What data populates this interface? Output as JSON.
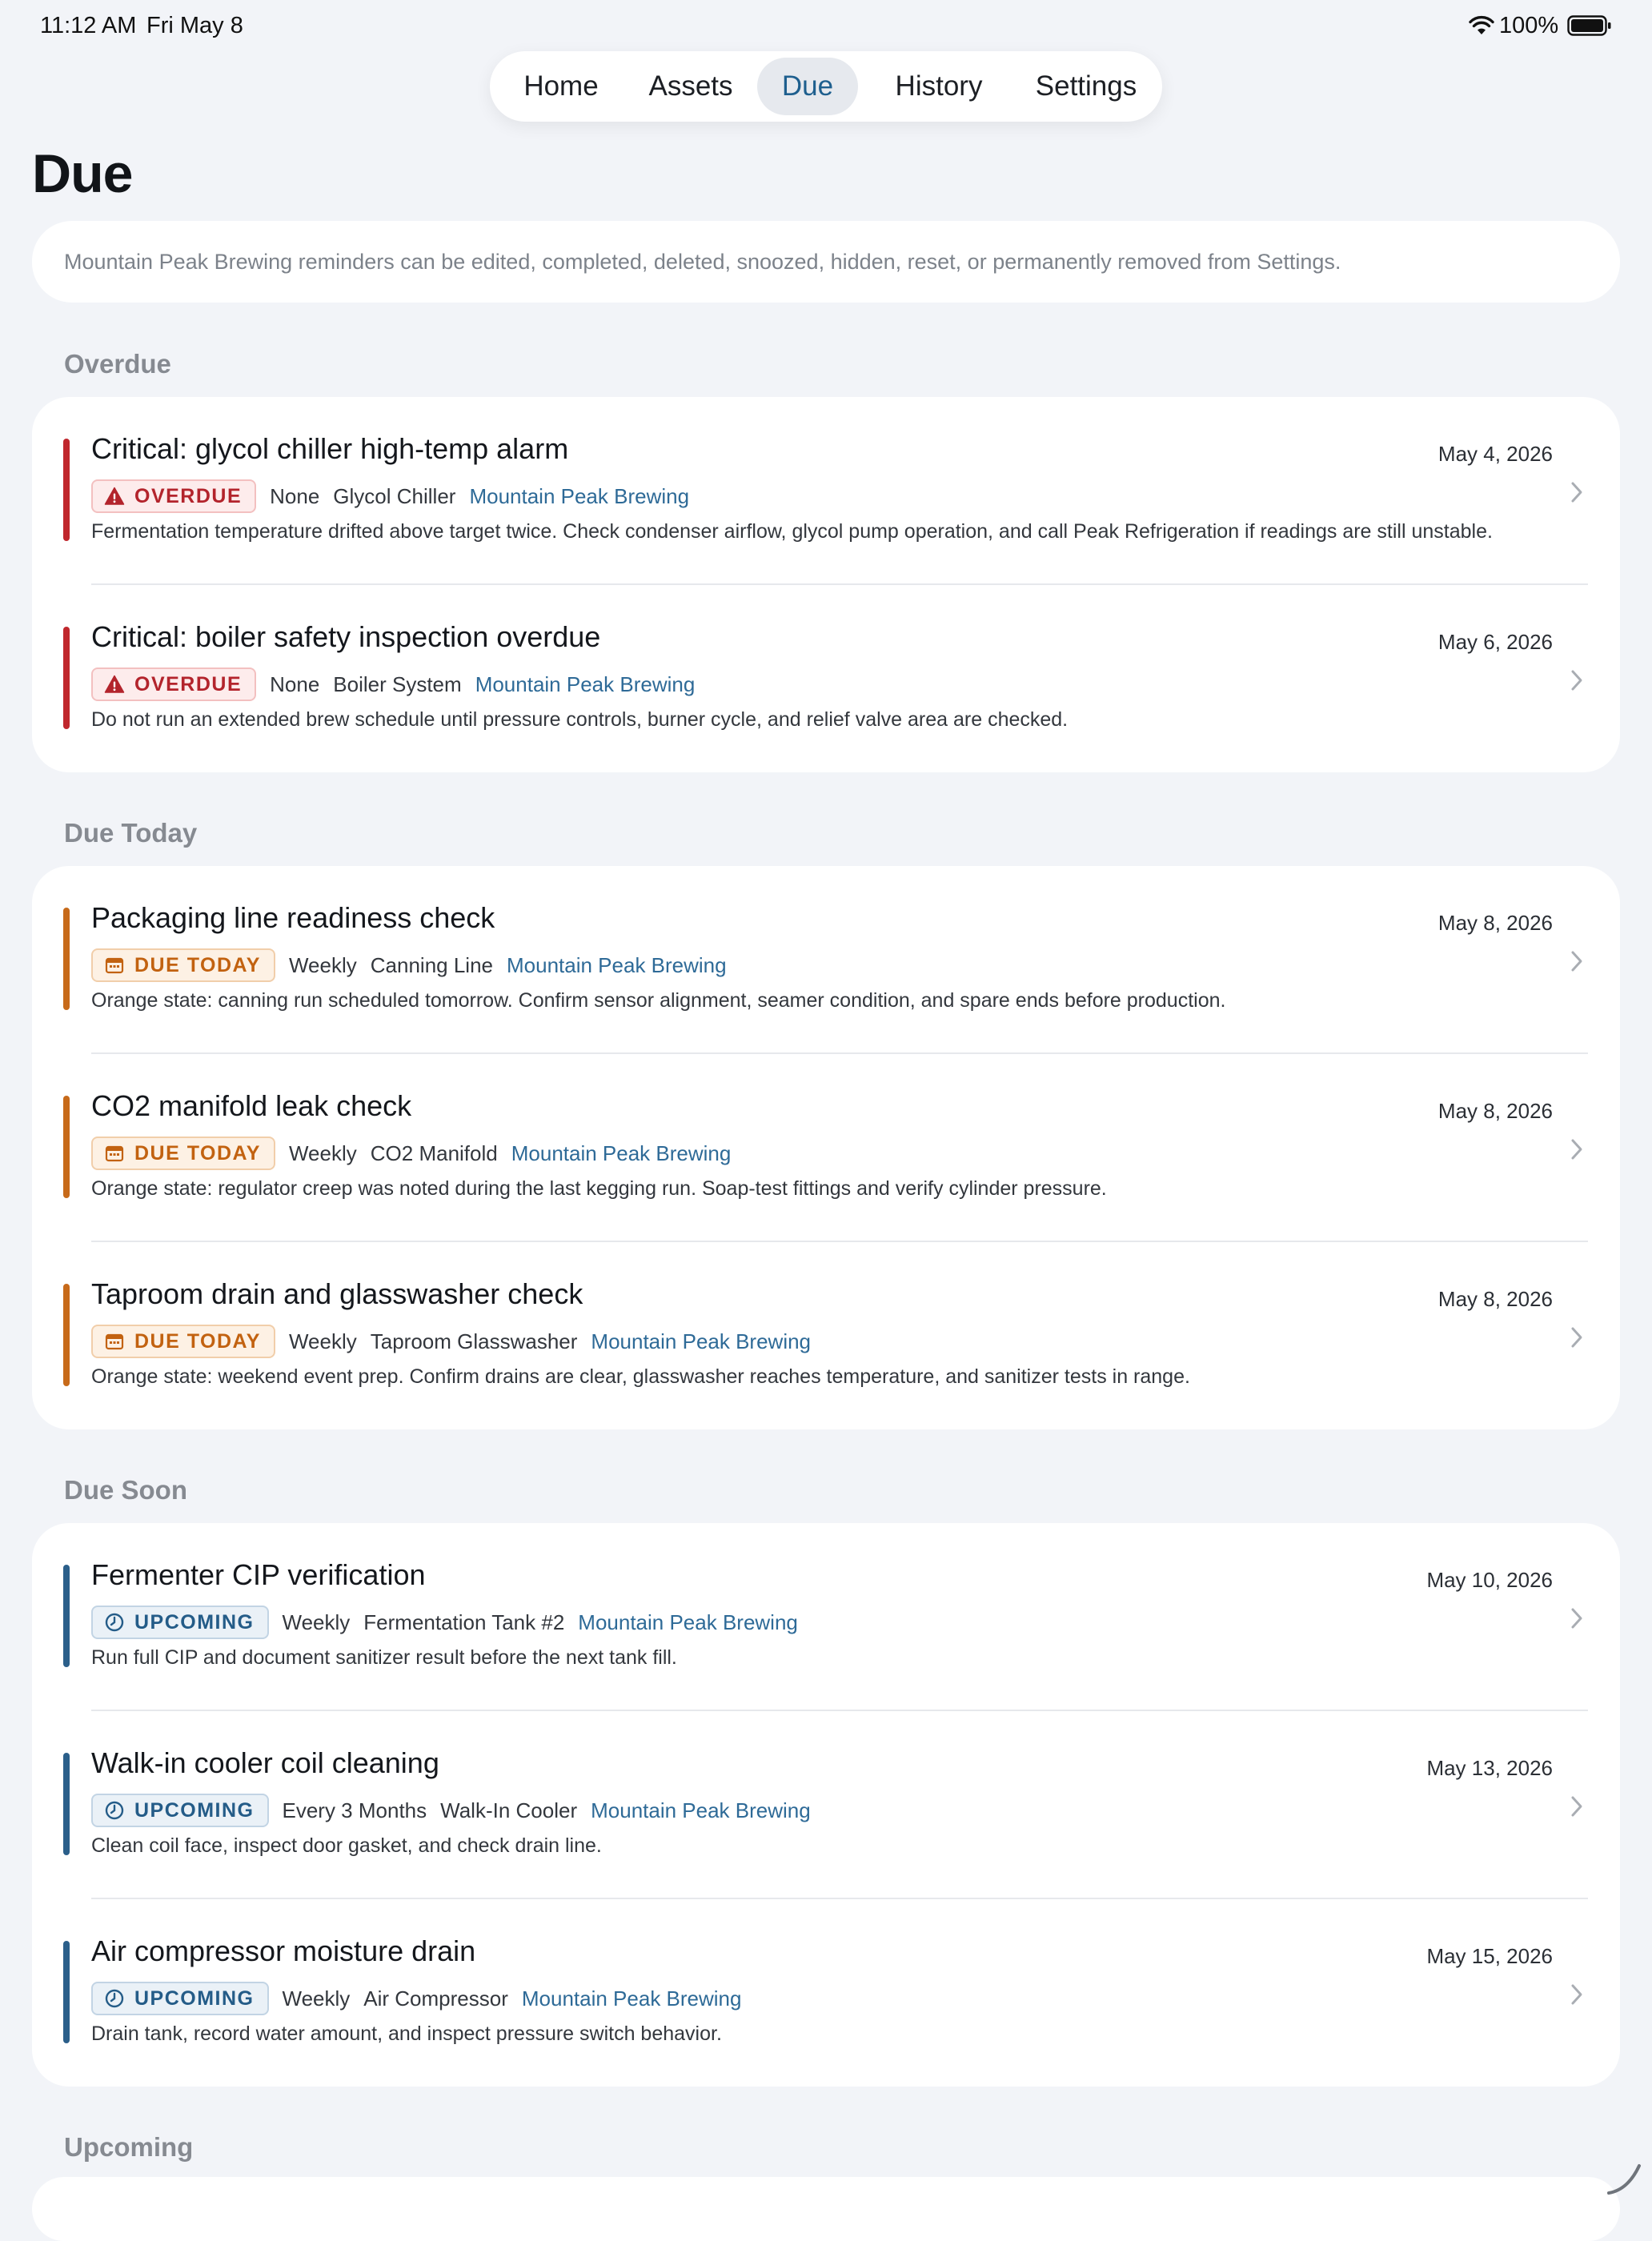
{
  "status_bar": {
    "time": "11:12 AM",
    "date": "Fri May 8",
    "battery": "100%"
  },
  "nav": {
    "tabs": [
      {
        "label": "Home"
      },
      {
        "label": "Assets"
      },
      {
        "label": "Due",
        "active": true
      },
      {
        "label": "History"
      },
      {
        "label": "Settings"
      }
    ]
  },
  "page": {
    "title": "Due",
    "info": "Mountain Peak Brewing reminders can be edited, completed, deleted, snoozed, hidden, reset, or permanently removed from Settings."
  },
  "colors": {
    "overdue": "#c0272d",
    "today": "#c76a1a",
    "upcoming": "#2b5f8a",
    "link": "#2e6a97"
  },
  "sections": [
    {
      "header": "Overdue",
      "items": [
        {
          "title": "Critical: glycol chiller high-temp alarm",
          "date": "May 4, 2026",
          "badge": "OVERDUE",
          "frequency": "None",
          "asset": "Glycol Chiller",
          "site": "Mountain Peak Brewing",
          "note": "Fermentation temperature drifted above target twice. Check condenser airflow, glycol pump operation, and call Peak Refrigeration if readings are still unstable."
        },
        {
          "title": "Critical: boiler safety inspection overdue",
          "date": "May 6, 2026",
          "badge": "OVERDUE",
          "frequency": "None",
          "asset": "Boiler System",
          "site": "Mountain Peak Brewing",
          "note": "Do not run an extended brew schedule until pressure controls, burner cycle, and relief valve area are checked."
        }
      ]
    },
    {
      "header": "Due Today",
      "items": [
        {
          "title": "Packaging line readiness check",
          "date": "May 8, 2026",
          "badge": "DUE TODAY",
          "frequency": "Weekly",
          "asset": "Canning Line",
          "site": "Mountain Peak Brewing",
          "note": "Orange state: canning run scheduled tomorrow. Confirm sensor alignment, seamer condition, and spare ends before production."
        },
        {
          "title": "CO2 manifold leak check",
          "date": "May 8, 2026",
          "badge": "DUE TODAY",
          "frequency": "Weekly",
          "asset": "CO2 Manifold",
          "site": "Mountain Peak Brewing",
          "note": "Orange state: regulator creep was noted during the last kegging run. Soap-test fittings and verify cylinder pressure."
        },
        {
          "title": "Taproom drain and glasswasher check",
          "date": "May 8, 2026",
          "badge": "DUE TODAY",
          "frequency": "Weekly",
          "asset": "Taproom Glasswasher",
          "site": "Mountain Peak Brewing",
          "note": "Orange state: weekend event prep. Confirm drains are clear, glasswasher reaches temperature, and sanitizer tests in range."
        }
      ]
    },
    {
      "header": "Due Soon",
      "items": [
        {
          "title": "Fermenter CIP verification",
          "date": "May 10, 2026",
          "badge": "UPCOMING",
          "frequency": "Weekly",
          "asset": "Fermentation Tank #2",
          "site": "Mountain Peak Brewing",
          "note": "Run full CIP and document sanitizer result before the next tank fill."
        },
        {
          "title": "Walk-in cooler coil cleaning",
          "date": "May 13, 2026",
          "badge": "UPCOMING",
          "frequency": "Every 3 Months",
          "asset": "Walk-In Cooler",
          "site": "Mountain Peak Brewing",
          "note": "Clean coil face, inspect door gasket, and check drain line."
        },
        {
          "title": "Air compressor moisture drain",
          "date": "May 15, 2026",
          "badge": "UPCOMING",
          "frequency": "Weekly",
          "asset": "Air Compressor",
          "site": "Mountain Peak Brewing",
          "note": "Drain tank, record water amount, and inspect pressure switch behavior."
        }
      ]
    },
    {
      "header": "Upcoming",
      "items": []
    }
  ]
}
